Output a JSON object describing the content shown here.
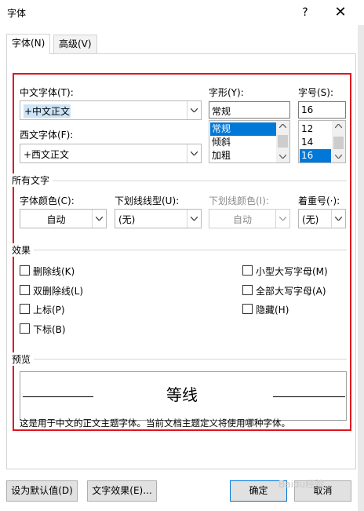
{
  "window": {
    "title": "字体",
    "help": "?",
    "close": "✕"
  },
  "tabs": [
    {
      "label": "字体(N)"
    },
    {
      "label": "高级(V)"
    }
  ],
  "font": {
    "chinese_label": "中文字体(T):",
    "chinese_value": "+中文正文",
    "western_label": "西文字体(F):",
    "western_value": "+西文正文",
    "style_label": "字形(Y):",
    "style_value": "常规",
    "style_options": [
      "常规",
      "倾斜",
      "加粗"
    ],
    "size_label": "字号(S):",
    "size_value": "16",
    "size_options": [
      "12",
      "14",
      "16"
    ]
  },
  "all_text": {
    "section_title": "所有文字",
    "color_label": "字体颜色(C):",
    "color_value": "自动",
    "underline_style_label": "下划线线型(U):",
    "underline_style_value": "(无)",
    "underline_color_label": "下划线颜色(I):",
    "underline_color_value": "自动",
    "emphasis_label": "着重号(·):",
    "emphasis_value": "(无)"
  },
  "effects": {
    "section_title": "效果",
    "left": [
      "删除线(K)",
      "双删除线(L)",
      "上标(P)",
      "下标(B)"
    ],
    "right": [
      "小型大写字母(M)",
      "全部大写字母(A)",
      "隐藏(H)"
    ]
  },
  "preview": {
    "section_title": "预览",
    "sample_text": "等线",
    "description": "这是用于中文的正文主题字体。当前文档主题定义将使用哪种字体。"
  },
  "buttons": {
    "set_default": "设为默认值(D)",
    "text_effects": "文字效果(E)...",
    "ok": "确定",
    "cancel": "取消"
  },
  "overlay": {
    "watermark": "Baidu经验",
    "highlight_color": "#e0141e"
  }
}
